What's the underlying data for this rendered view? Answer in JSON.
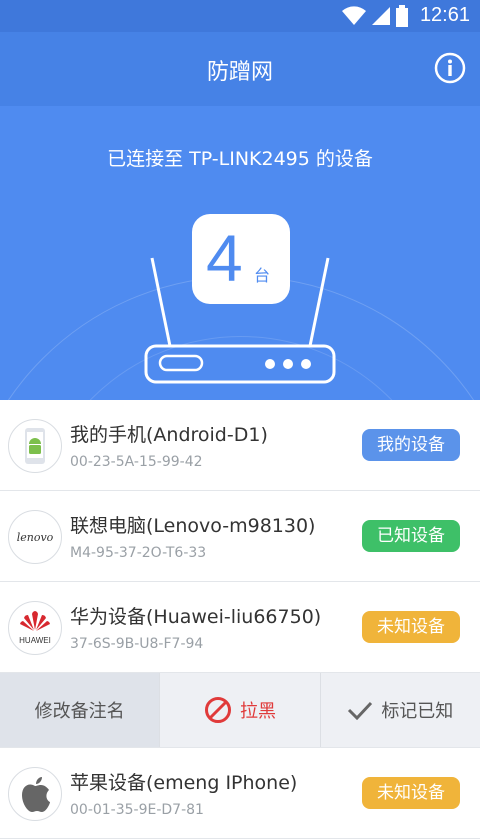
{
  "status_bar": {
    "time": "12:61"
  },
  "app": {
    "title": "防蹭网"
  },
  "hero": {
    "connected_text": "已连接至 TP-LINK2495 的设备",
    "device_count": "4",
    "device_unit": "台"
  },
  "devices": [
    {
      "name": "我的手机(Android-D1)",
      "mac": "00-23-5A-15-99-42",
      "badge": "我的设备",
      "avatar": "android-icon",
      "badge_color": "#5b93ea"
    },
    {
      "name": "联想电脑(Lenovo-m98130)",
      "mac": "M4-95-37-2O-T6-33",
      "badge": "已知设备",
      "avatar": "lenovo-logo",
      "avatar_text": "lenovo",
      "badge_color": "#3ec068"
    },
    {
      "name": "华为设备(Huawei-liu66750)",
      "mac": "37-6S-9B-U8-F7-94",
      "badge": "未知设备",
      "avatar": "huawei-logo",
      "avatar_text": "HUAWEI",
      "badge_color": "#f0b43a"
    },
    {
      "name": "苹果设备(emeng IPhone)",
      "mac": "00-01-35-9E-D7-81",
      "badge": "未知设备",
      "avatar": "apple-logo",
      "badge_color": "#f0b43a"
    }
  ],
  "actions": {
    "edit_label": "修改备注名",
    "block_label": "拉黑",
    "mark_known_label": "标记已知"
  }
}
